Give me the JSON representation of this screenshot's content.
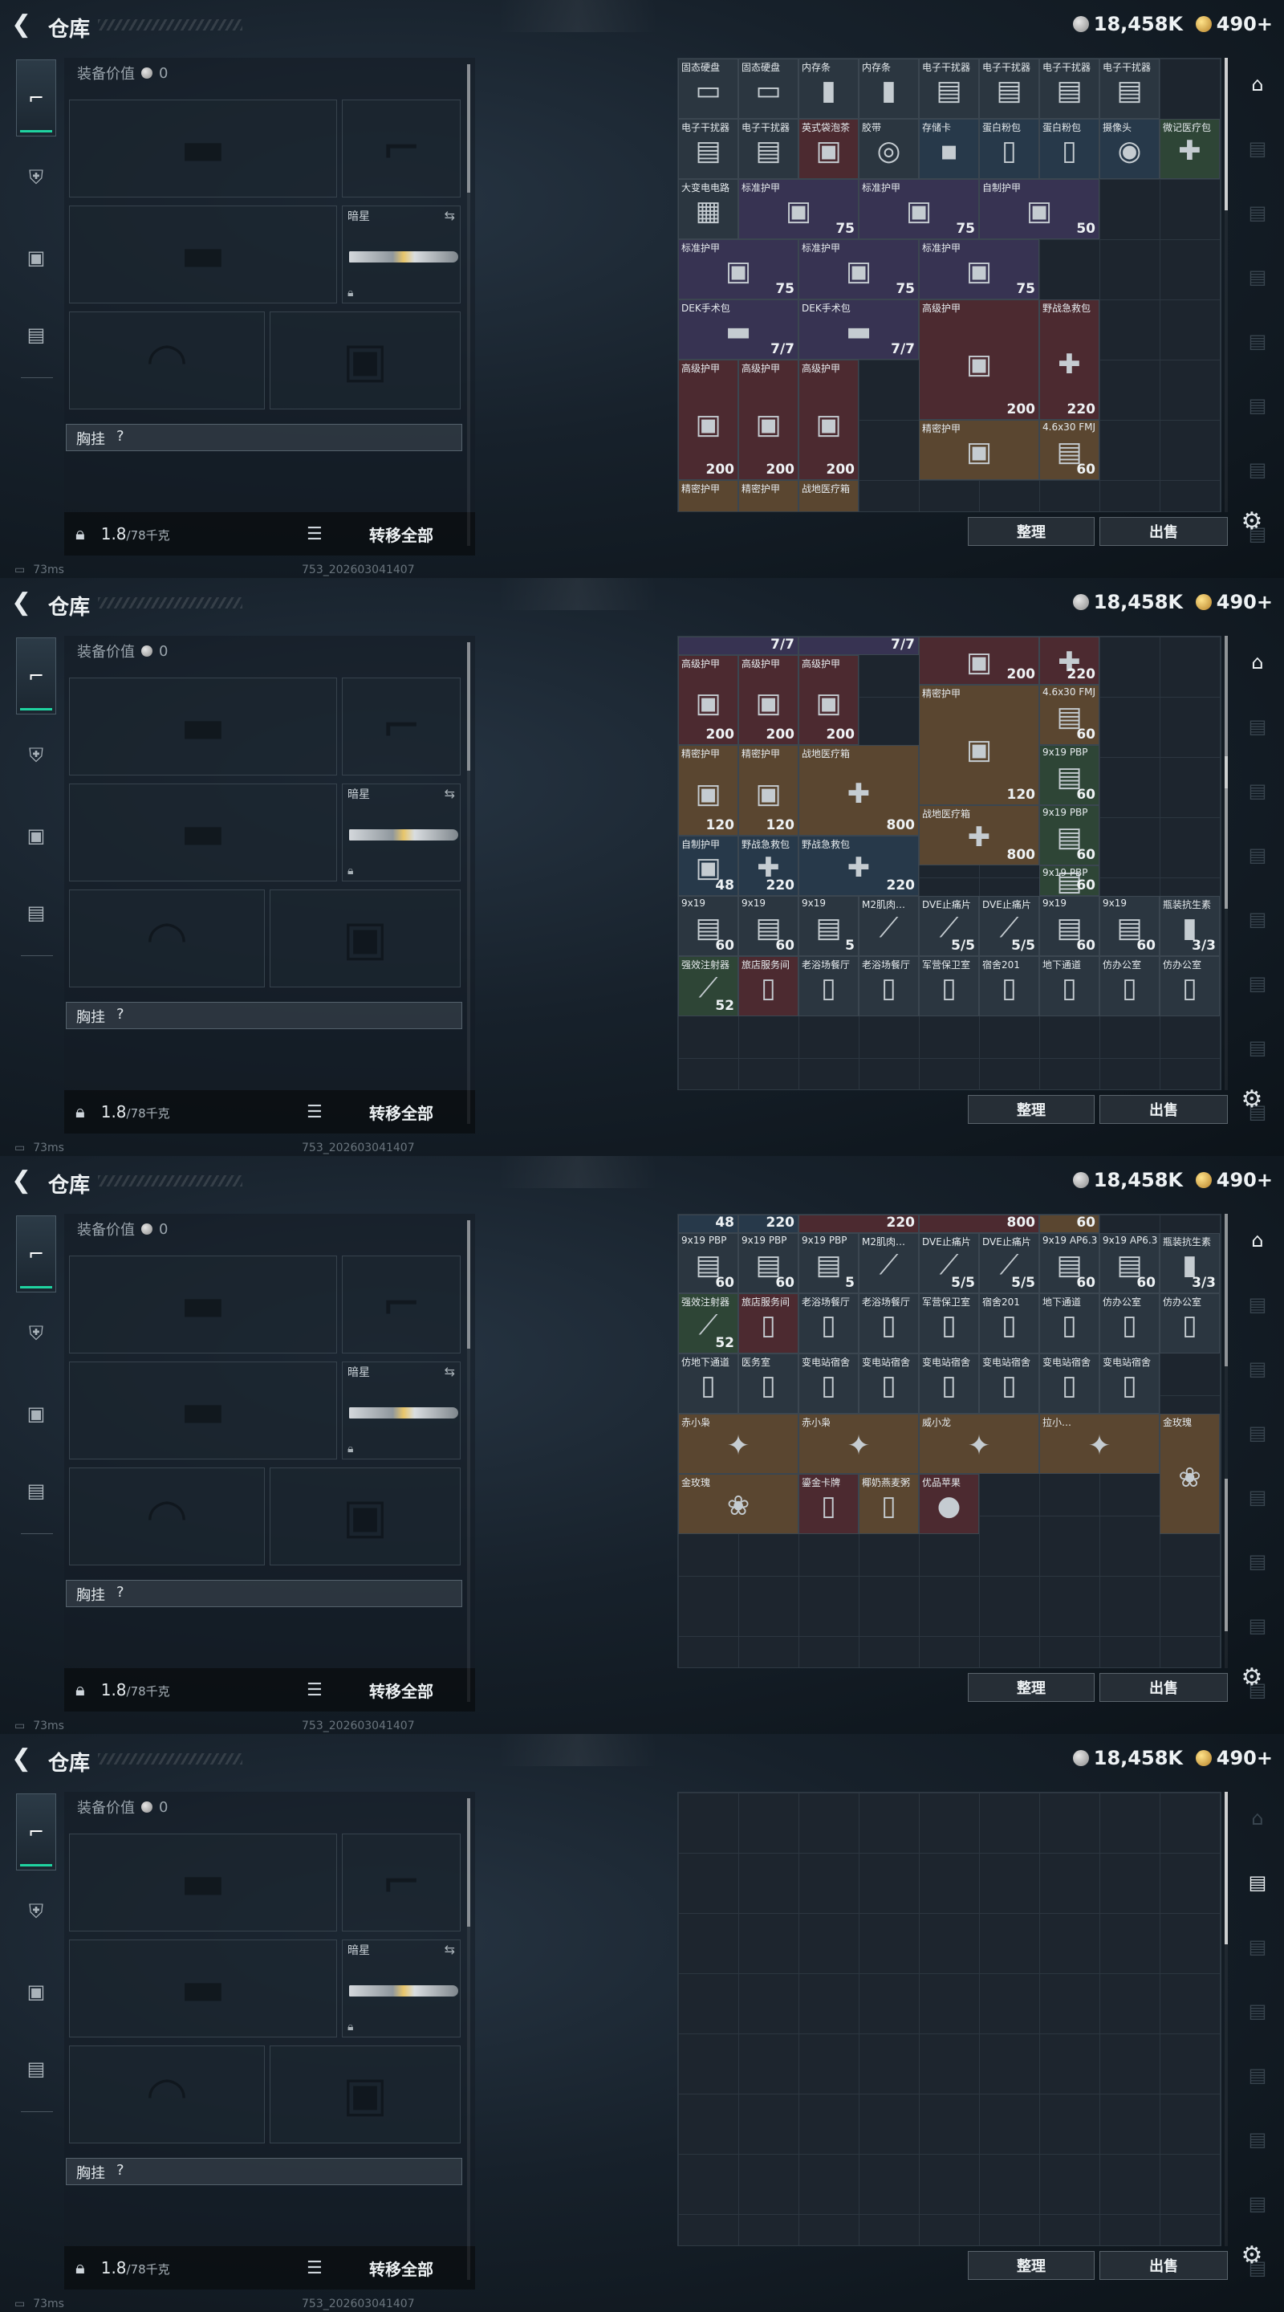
{
  "header": {
    "title": "仓库",
    "currency_1": "18,458K",
    "currency_2": "490+"
  },
  "loadout": {
    "equip_value_label": "装备价值",
    "equip_value": "0",
    "melee_name": "暗星",
    "chest_label": "胸挂",
    "chest_q": "?",
    "weight": "1.8",
    "weight_max": "/78千克",
    "transfer_label": "转移全部"
  },
  "status": {
    "ping": "73ms",
    "build": "753_202603041407"
  },
  "buttons": {
    "sort": "整理",
    "sell": "出售"
  },
  "icons": {
    "back": "back-arrow-icon",
    "gun": "gun-icon",
    "armor": "armor-icon",
    "vest": "vest-icon",
    "bag": "bag-icon",
    "lock": "lock-icon",
    "swap": "swap-icon",
    "list": "list-icon",
    "gear": "gear-icon"
  },
  "panels": [
    {
      "items": [
        {
          "n": "固态硬盘",
          "c": ""
        },
        {
          "n": "固态硬盘",
          "c": ""
        },
        {
          "n": "内存条",
          "c": ""
        },
        {
          "n": "内存条",
          "c": ""
        },
        {
          "n": "电子干扰器",
          "c": ""
        },
        {
          "n": "电子干扰器",
          "c": ""
        },
        {
          "n": "电子干扰器",
          "c": ""
        },
        {
          "n": "电子干扰器",
          "c": ""
        },
        {
          "n": "电子干扰器",
          "c": ""
        },
        {
          "n": "电子干扰器",
          "c": ""
        },
        {
          "n": "英式袋泡茶",
          "c": ""
        },
        {
          "n": "胶带",
          "c": ""
        },
        {
          "n": "存储卡",
          "c": ""
        },
        {
          "n": "蛋白粉包",
          "c": ""
        },
        {
          "n": "蛋白粉包",
          "c": ""
        },
        {
          "n": "摄像头",
          "c": ""
        },
        {
          "n": "微记医疗包",
          "c": ""
        },
        {
          "n": "大变电电路",
          "c": ""
        },
        {
          "n": "标准护甲",
          "c": "75"
        },
        {
          "n": "标准护甲",
          "c": "75"
        },
        {
          "n": "自制护甲",
          "c": "50"
        },
        {
          "n": "标准护甲",
          "c": "75"
        },
        {
          "n": "标准护甲",
          "c": "75"
        },
        {
          "n": "标准护甲",
          "c": "75"
        },
        {
          "n": "DEK手术包",
          "c": "7/7"
        },
        {
          "n": "DEK手术包",
          "c": "7/7"
        },
        {
          "n": "高级护甲",
          "c": "200"
        },
        {
          "n": "野战急救包",
          "c": "220"
        },
        {
          "n": "高级护甲",
          "c": "200"
        },
        {
          "n": "高级护甲",
          "c": "200"
        },
        {
          "n": "高级护甲",
          "c": "200"
        },
        {
          "n": "精密护甲",
          "c": ""
        },
        {
          "n": "4.6x30 FMJ",
          "c": "60"
        },
        {
          "n": "精密护甲",
          "c": ""
        },
        {
          "n": "精密护甲",
          "c": ""
        },
        {
          "n": "战地医疗箱",
          "c": ""
        }
      ]
    },
    {
      "items": [
        {
          "n": "",
          "c": "7/7"
        },
        {
          "n": "",
          "c": "7/7"
        },
        {
          "n": "",
          "c": "200"
        },
        {
          "n": "",
          "c": "220"
        },
        {
          "n": "高级护甲",
          "c": "200"
        },
        {
          "n": "高级护甲",
          "c": "200"
        },
        {
          "n": "高级护甲",
          "c": "200"
        },
        {
          "n": "精密护甲",
          "c": "120"
        },
        {
          "n": "4.6x30 FMJ",
          "c": "60"
        },
        {
          "n": "精密护甲",
          "c": "120"
        },
        {
          "n": "精密护甲",
          "c": "120"
        },
        {
          "n": "战地医疗箱",
          "c": "800"
        },
        {
          "n": "9x19 PBP",
          "c": "60"
        },
        {
          "n": "战地医疗箱",
          "c": "800"
        },
        {
          "n": "9x19 PBP",
          "c": "60"
        },
        {
          "n": "自制护甲",
          "c": "48"
        },
        {
          "n": "野战急救包",
          "c": "220"
        },
        {
          "n": "野战急救包",
          "c": "220"
        },
        {
          "n": "9x19 PBP",
          "c": "60"
        },
        {
          "n": "9x19",
          "c": "60"
        },
        {
          "n": "9x19",
          "c": "60"
        },
        {
          "n": "9x19",
          "c": "5"
        },
        {
          "n": "M2肌肉…",
          "c": ""
        },
        {
          "n": "DVE止痛片",
          "c": "5/5"
        },
        {
          "n": "DVE止痛片",
          "c": "5/5"
        },
        {
          "n": "9x19",
          "c": "60"
        },
        {
          "n": "9x19",
          "c": "60"
        },
        {
          "n": "瓶装抗生素",
          "c": "3/3"
        },
        {
          "n": "强效注射器",
          "c": "52"
        },
        {
          "n": "旅店服务间",
          "c": ""
        },
        {
          "n": "老浴场餐厅",
          "c": ""
        },
        {
          "n": "老浴场餐厅",
          "c": ""
        },
        {
          "n": "军营保卫室",
          "c": ""
        },
        {
          "n": "宿舍201",
          "c": ""
        },
        {
          "n": "地下通道",
          "c": ""
        },
        {
          "n": "仿办公室",
          "c": ""
        },
        {
          "n": "仿办公室",
          "c": ""
        }
      ]
    },
    {
      "items": [
        {
          "n": "",
          "c": "48"
        },
        {
          "n": "",
          "c": "220"
        },
        {
          "n": "",
          "c": "220"
        },
        {
          "n": "",
          "c": "800"
        },
        {
          "n": "",
          "c": "60"
        },
        {
          "n": "9x19 PBP",
          "c": "60"
        },
        {
          "n": "9x19 PBP",
          "c": "60"
        },
        {
          "n": "9x19 PBP",
          "c": "5"
        },
        {
          "n": "M2肌肉…",
          "c": ""
        },
        {
          "n": "DVE止痛片",
          "c": "5/5"
        },
        {
          "n": "DVE止痛片",
          "c": "5/5"
        },
        {
          "n": "9x19 AP6.3",
          "c": "60"
        },
        {
          "n": "9x19 AP6.3",
          "c": "60"
        },
        {
          "n": "瓶装抗生素",
          "c": "3/3"
        },
        {
          "n": "强效注射器",
          "c": "52"
        },
        {
          "n": "旅店服务间",
          "c": ""
        },
        {
          "n": "老浴场餐厅",
          "c": ""
        },
        {
          "n": "老浴场餐厅",
          "c": ""
        },
        {
          "n": "军营保卫室",
          "c": ""
        },
        {
          "n": "宿舍201",
          "c": ""
        },
        {
          "n": "地下通道",
          "c": ""
        },
        {
          "n": "仿办公室",
          "c": ""
        },
        {
          "n": "仿办公室",
          "c": ""
        },
        {
          "n": "仿地下通道",
          "c": ""
        },
        {
          "n": "医务室",
          "c": ""
        },
        {
          "n": "变电站宿舍",
          "c": ""
        },
        {
          "n": "变电站宿舍",
          "c": ""
        },
        {
          "n": "变电站宿舍",
          "c": ""
        },
        {
          "n": "变电站宿舍",
          "c": ""
        },
        {
          "n": "变电站宿舍",
          "c": ""
        },
        {
          "n": "变电站宿舍",
          "c": ""
        },
        {
          "n": "赤小枭",
          "c": ""
        },
        {
          "n": "赤小枭",
          "c": ""
        },
        {
          "n": "威小龙",
          "c": ""
        },
        {
          "n": "拉小…",
          "c": ""
        },
        {
          "n": "金玫瑰",
          "c": ""
        },
        {
          "n": "金玫瑰",
          "c": ""
        },
        {
          "n": "鎏金卡牌",
          "c": ""
        },
        {
          "n": "椰奶燕麦粥",
          "c": ""
        },
        {
          "n": "优品苹果",
          "c": ""
        }
      ]
    },
    {
      "items": []
    }
  ]
}
